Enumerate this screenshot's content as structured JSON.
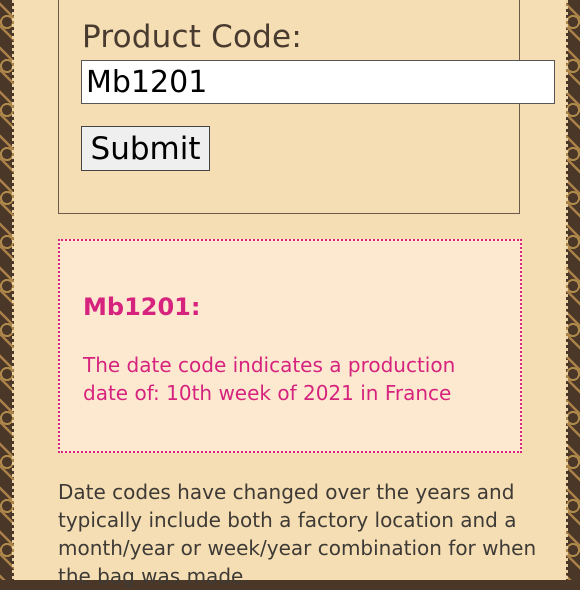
{
  "form": {
    "label": "Product Code:",
    "input_value": "Mb1201",
    "submit_label": "Submit"
  },
  "result": {
    "code_heading": "Mb1201:",
    "message": "The date code indicates a production date of: 10th week of 2021 in France"
  },
  "info": {
    "text": "Date codes have changed over the years and typically include both a factory location and a month/year or week/year combination for when the bag was made."
  },
  "colors": {
    "accent": "#d6247e",
    "page_background": "#f5deb3",
    "result_background": "#fde8d0",
    "border_pattern": "#4a3728"
  }
}
